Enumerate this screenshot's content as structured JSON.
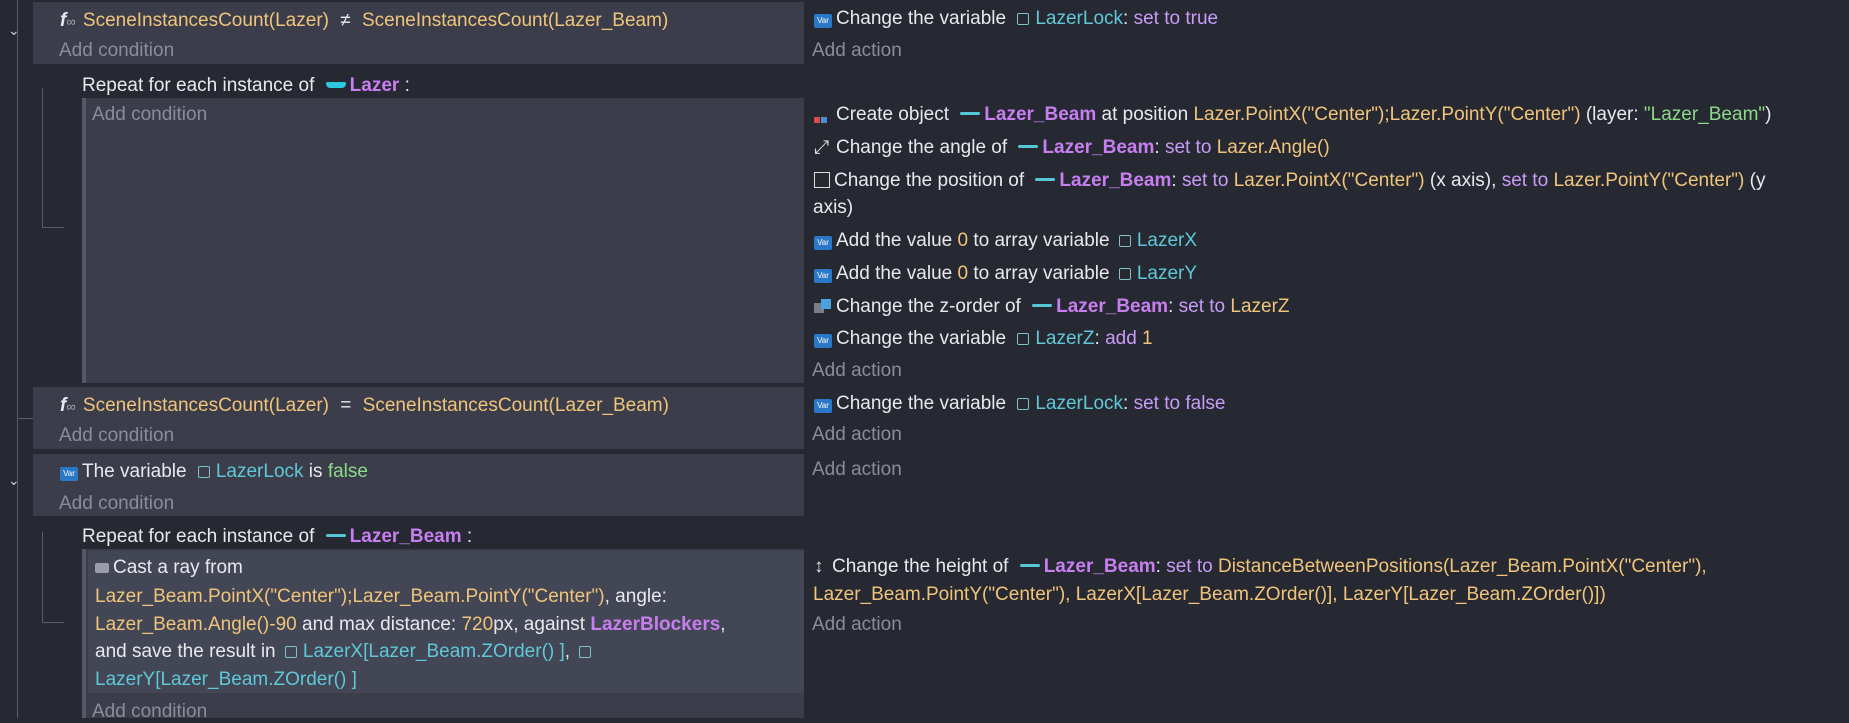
{
  "colors": {
    "background": "#262932",
    "condition_panel": "#3b3e4a",
    "nested_panel": "#434654",
    "function": "#f0c47a",
    "object": "#c77ff0",
    "variable": "#5fc8d8",
    "operator": "#c89bf7",
    "string": "#8cd98a"
  },
  "add_condition": "Add condition",
  "add_action": "Add action",
  "events": {
    "e1": {
      "cond": {
        "fn1": "SceneInstancesCount(Lazer)",
        "op": "≠",
        "fn2": "SceneInstancesCount(Lazer_Beam)"
      },
      "action": {
        "text": "Change the variable",
        "var": "LazerLock",
        "sep": ":",
        "op": "set to true"
      }
    },
    "e1_repeat": {
      "prefix": "Repeat for each instance of",
      "object": "Lazer",
      "colon": ":",
      "a1": {
        "t1": "Create object",
        "obj": "Lazer_Beam",
        "t2": "at position",
        "v1": "Lazer.PointX(\"Center\")",
        "semi": ";",
        "v2": "Lazer.PointY(\"Center\")",
        "t3": "(layer:",
        "str": "\"Lazer_Beam\"",
        "t4": ")"
      },
      "a2": {
        "t1": "Change the angle of",
        "obj": "Lazer_Beam",
        "colon": ":",
        "op": "set to",
        "v": "Lazer.Angle()"
      },
      "a3": {
        "t1": "Change the position of",
        "obj": "Lazer_Beam",
        "colon": ":",
        "op": "set to",
        "v1": "Lazer.PointX(\"Center\")",
        "t2": "(x axis),",
        "op2": "set to",
        "v2": "Lazer.PointY(\"Center\")",
        "t3": "(y",
        "t4": "axis)"
      },
      "a4": {
        "t1": "Add the value",
        "v": "0",
        "t2": "to array variable",
        "var": "LazerX"
      },
      "a5": {
        "t1": "Add the value",
        "v": "0",
        "t2": "to array variable",
        "var": "LazerY"
      },
      "a6": {
        "t1": "Change the z-order of",
        "obj": "Lazer_Beam",
        "colon": ":",
        "op": "set to",
        "v": "LazerZ"
      },
      "a7": {
        "t1": "Change the variable",
        "var": "LazerZ",
        "colon": ":",
        "op": "add",
        "v": "1"
      }
    },
    "e2": {
      "cond": {
        "fn1": "SceneInstancesCount(Lazer)",
        "op": "=",
        "fn2": "SceneInstancesCount(Lazer_Beam)"
      },
      "action": {
        "text": "Change the variable",
        "var": "LazerLock",
        "sep": ":",
        "op": "set to false"
      }
    },
    "e3": {
      "cond": {
        "t1": "The variable",
        "var": "LazerLock",
        "t2": "is",
        "v": "false"
      }
    },
    "e3_repeat": {
      "prefix": "Repeat for each instance of",
      "object": "Lazer_Beam",
      "colon": ":",
      "c1": {
        "t1": "Cast a ray from",
        "v1": "Lazer_Beam.PointX(\"Center\")",
        "semi": ";",
        "v2": "Lazer_Beam.PointY(\"Center\")",
        "t2": ", angle:",
        "v3": "Lazer_Beam.Angle()-90",
        "t3": "and max distance:",
        "v4": "720",
        "t4": "px, against",
        "obj": "LazerBlockers",
        "t5": ",",
        "t6": "and save the result in",
        "var1": "LazerX[Lazer_Beam.ZOrder() ]",
        "t7": ",",
        "var2": "LazerY[Lazer_Beam.ZOrder() ]"
      },
      "a1": {
        "t1": "Change the height of",
        "obj": "Lazer_Beam",
        "colon": ":",
        "op": "set to",
        "v1": "DistanceBetweenPositions(Lazer_Beam.PointX(\"Center\"),",
        "v2": "Lazer_Beam.PointY(\"Center\"), LazerX[Lazer_Beam.ZOrder()], LazerY[Lazer_Beam.ZOrder()])"
      }
    }
  }
}
